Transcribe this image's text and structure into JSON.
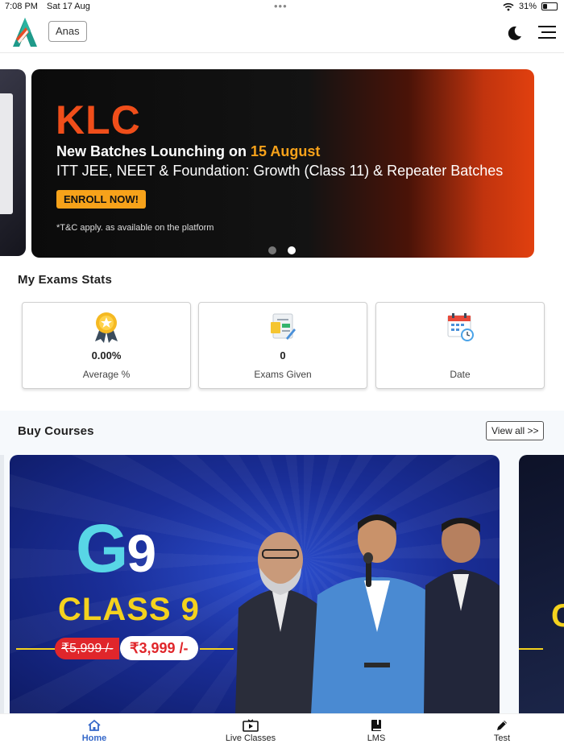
{
  "status_bar": {
    "time": "7:08 PM",
    "date": "Sat 17 Aug",
    "battery": "31%",
    "battery_level": 0.31
  },
  "header": {
    "user_name": "Anas"
  },
  "banner": {
    "brand": "KLC",
    "headline_prefix": "New Batches Lounching on ",
    "headline_highlight": "15 August",
    "subline": "ITT JEE, NEET & Foundation: Growth (Class 11) & Repeater Batches",
    "cta": "ENROLL NOW!",
    "disclaimer": "*T&C apply. as available on the platform",
    "active_slide": 2,
    "slide_count": 2
  },
  "stats": {
    "title": "My Exams Stats",
    "cards": [
      {
        "icon": "award-medal-icon",
        "value": "0.00%",
        "label": "Average %"
      },
      {
        "icon": "exam-sheet-icon",
        "value": "0",
        "label": "Exams Given"
      },
      {
        "icon": "calendar-clock-icon",
        "value": "",
        "label": "Date"
      }
    ]
  },
  "courses": {
    "title": "Buy Courses",
    "view_all": "View all >>",
    "featured": {
      "code_letter": "G",
      "code_number": "9",
      "name": "CLASS 9",
      "old_price": "₹5,999 /-",
      "new_price": "₹3,999 /-"
    },
    "next_card_letter": "C"
  },
  "bottom_nav": {
    "items": [
      {
        "icon": "home-icon",
        "label": "Home",
        "active": true
      },
      {
        "icon": "tv-play-icon",
        "label": "Live Classes",
        "active": false
      },
      {
        "icon": "book-icon",
        "label": "LMS",
        "active": false
      },
      {
        "icon": "pencil-icon",
        "label": "Test",
        "active": false
      }
    ]
  },
  "colors": {
    "accent": "#3568c9",
    "brand_orange": "#f04e1a",
    "highlight": "#f7a21a",
    "class_yellow": "#f4d21e",
    "price_red": "#e0262b"
  }
}
